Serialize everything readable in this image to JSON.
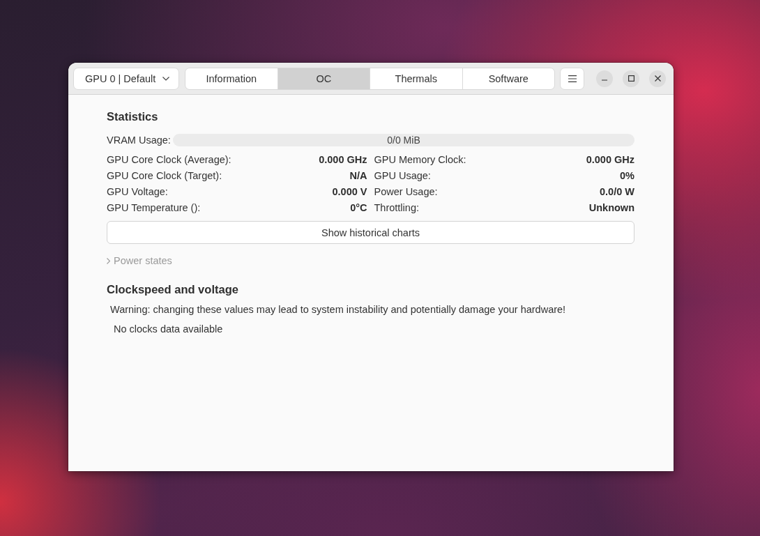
{
  "header": {
    "gpu_selector": {
      "value": "GPU 0 | Default"
    },
    "tabs": [
      {
        "label": "Information",
        "selected": false
      },
      {
        "label": "OC",
        "selected": true
      },
      {
        "label": "Thermals",
        "selected": false
      },
      {
        "label": "Software",
        "selected": false
      }
    ]
  },
  "statistics": {
    "title": "Statistics",
    "vram": {
      "label": "VRAM Usage:",
      "level": 0,
      "reading": "0/0 MiB"
    },
    "left_column": [
      {
        "label": "GPU Core Clock (Average):",
        "value": "0.000 GHz"
      },
      {
        "label": "GPU Core Clock (Target):",
        "value": "N/A"
      },
      {
        "label": "GPU Voltage:",
        "value": "0.000 V"
      },
      {
        "label": "GPU Temperature ():",
        "value": "0°C"
      }
    ],
    "right_column": [
      {
        "label": "GPU Memory Clock:",
        "value": "0.000 GHz"
      },
      {
        "label": "GPU Usage:",
        "value": "0%"
      },
      {
        "label": "Power Usage:",
        "value": "0.0/0 W"
      },
      {
        "label": "Throttling:",
        "value": "Unknown"
      }
    ],
    "charts_button": "Show historical charts"
  },
  "power_states": {
    "label": "Power states",
    "expanded": false,
    "disabled": true
  },
  "clockspeed": {
    "title": "Clockspeed and voltage",
    "warning": "Warning: changing these values may lead to system instability and potentially damage your hardware!",
    "empty_message": "No clocks data available"
  }
}
